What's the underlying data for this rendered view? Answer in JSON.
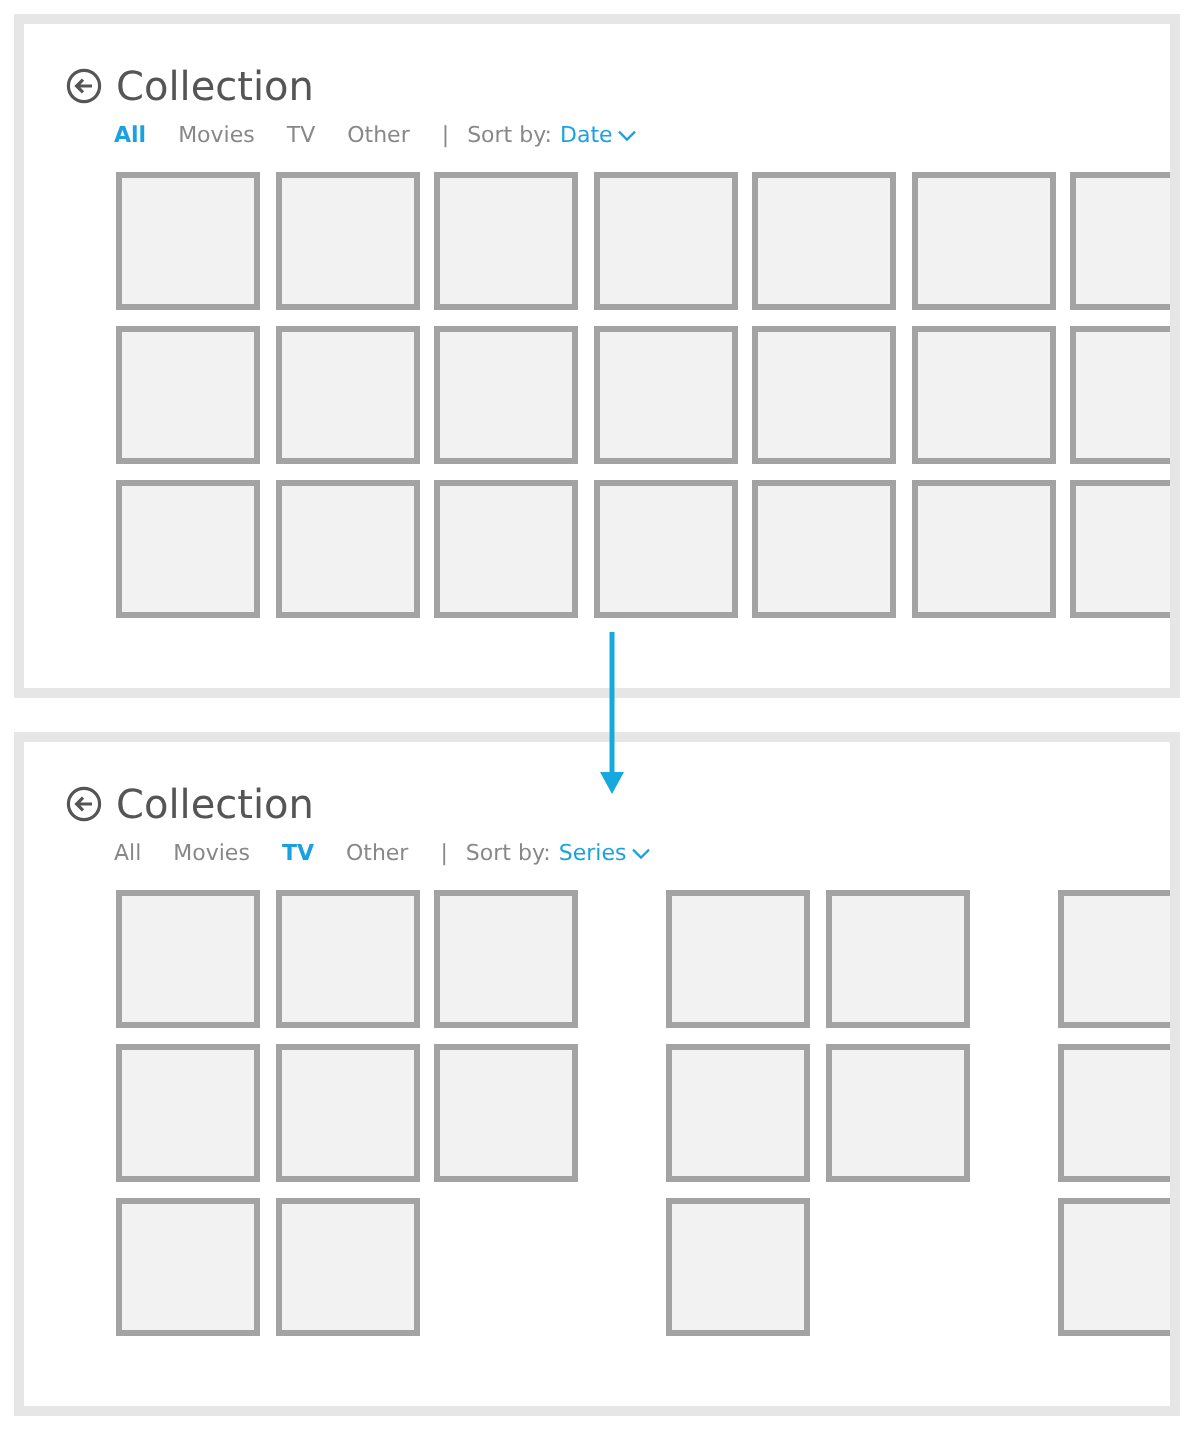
{
  "panels": [
    {
      "title": "Collection",
      "filters": [
        {
          "label": "All",
          "selected": true
        },
        {
          "label": "Movies",
          "selected": false
        },
        {
          "label": "TV",
          "selected": false
        },
        {
          "label": "Other",
          "selected": false
        }
      ],
      "separator": "|",
      "sort_label": "Sort by:",
      "sort_value": "Date",
      "groups": [
        {
          "columns": [
            {
              "tiles": [
                {
                  "kind": "tile"
                },
                {
                  "kind": "tile"
                },
                {
                  "kind": "tile"
                }
              ]
            },
            {
              "tiles": [
                {
                  "kind": "tile"
                },
                {
                  "kind": "tile"
                },
                {
                  "kind": "tile"
                }
              ]
            },
            {
              "tiles": [
                {
                  "kind": "tile"
                },
                {
                  "kind": "tile"
                },
                {
                  "kind": "tile"
                }
              ]
            },
            {
              "tiles": [
                {
                  "kind": "tile"
                },
                {
                  "kind": "tile"
                },
                {
                  "kind": "tile"
                }
              ]
            },
            {
              "tiles": [
                {
                  "kind": "tile"
                },
                {
                  "kind": "tile"
                },
                {
                  "kind": "tile"
                }
              ]
            },
            {
              "tiles": [
                {
                  "kind": "tile"
                },
                {
                  "kind": "tile"
                },
                {
                  "kind": "tile"
                }
              ]
            },
            {
              "tiles": [
                {
                  "kind": "tile"
                },
                {
                  "kind": "tile"
                },
                {
                  "kind": "tile"
                }
              ]
            }
          ]
        }
      ]
    },
    {
      "title": "Collection",
      "filters": [
        {
          "label": "All",
          "selected": false
        },
        {
          "label": "Movies",
          "selected": false
        },
        {
          "label": "TV",
          "selected": true
        },
        {
          "label": "Other",
          "selected": false
        }
      ],
      "separator": "|",
      "sort_label": "Sort by:",
      "sort_value": "Series",
      "groups": [
        {
          "columns": [
            {
              "tiles": [
                {
                  "kind": "tile"
                },
                {
                  "kind": "tile"
                },
                {
                  "kind": "tile"
                }
              ]
            },
            {
              "tiles": [
                {
                  "kind": "tile"
                },
                {
                  "kind": "tile"
                },
                {
                  "kind": "tile"
                }
              ]
            },
            {
              "tiles": [
                {
                  "kind": "tile"
                },
                {
                  "kind": "tile"
                }
              ]
            }
          ]
        },
        {
          "columns": [
            {
              "tiles": [
                {
                  "kind": "tile"
                },
                {
                  "kind": "tile"
                },
                {
                  "kind": "tile"
                }
              ]
            },
            {
              "tiles": [
                {
                  "kind": "tile"
                },
                {
                  "kind": "tile"
                }
              ]
            }
          ]
        },
        {
          "columns": [
            {
              "tiles": [
                {
                  "kind": "tile"
                },
                {
                  "kind": "tile"
                },
                {
                  "kind": "tile"
                }
              ]
            }
          ]
        }
      ]
    }
  ]
}
